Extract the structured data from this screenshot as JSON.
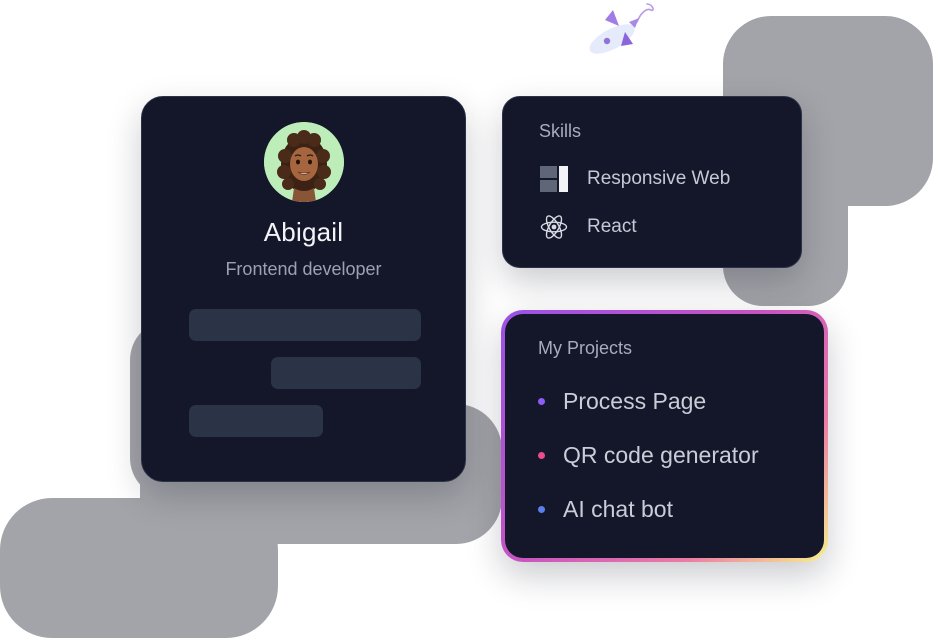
{
  "profile": {
    "avatar_icon": "memoji-avatar-icon",
    "name": "Abigail",
    "role": "Frontend developer"
  },
  "skills": {
    "heading": "Skills",
    "items": [
      {
        "label": "Responsive Web",
        "icon": "responsive-layout-icon"
      },
      {
        "label": "React",
        "icon": "react-atom-icon"
      }
    ]
  },
  "projects": {
    "heading": "My Projects",
    "items": [
      {
        "label": "Process Page",
        "bullet_color": "#8b5cf6"
      },
      {
        "label": "QR code generator",
        "bullet_color": "#ec4b8c"
      },
      {
        "label": "AI chat bot",
        "bullet_color": "#5b7fe9"
      }
    ]
  },
  "decor": {
    "rocket_icon": "rocket-icon"
  },
  "colors": {
    "card_background": "#131729",
    "background_blob": "#a3a4a9",
    "avatar_background": "#bdeeb9",
    "skeleton": "#2b3346",
    "gradient_border": [
      "#9a52e6",
      "#c653c2",
      "#ec7aa5",
      "#f6f08d"
    ]
  }
}
